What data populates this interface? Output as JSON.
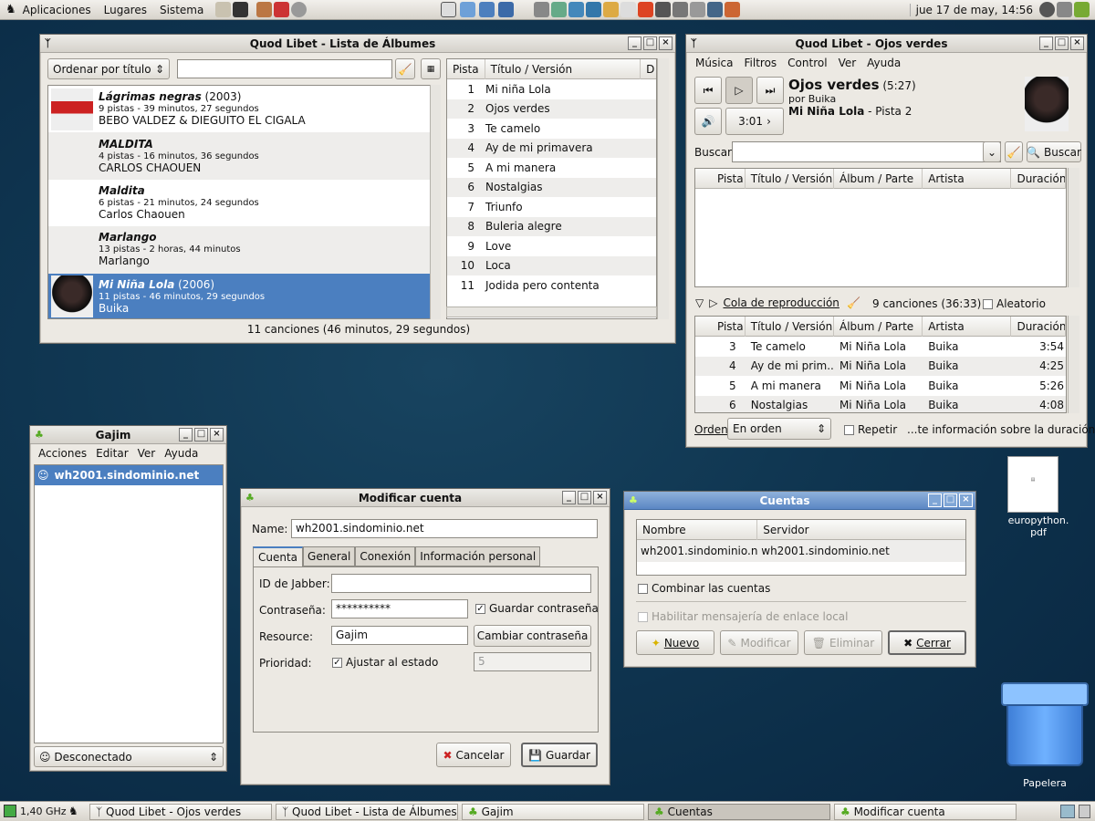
{
  "top_panel": {
    "menus": [
      "Aplicaciones",
      "Lugares",
      "Sistema"
    ],
    "clock": "jue 17 de may, 14:56"
  },
  "albums_window": {
    "title": "Quod Libet - Lista de Álbumes",
    "sort": "Ordenar por título",
    "albums": [
      {
        "title": "Lágrimas negras",
        "year": " (2003)",
        "info": "9 pistas - 39 minutos, 27 segundos",
        "artist": "BEBO VALDEZ & DIEGUITO EL CIGALA"
      },
      {
        "title": "MALDITA",
        "year": "",
        "info": "4 pistas - 16 minutos, 36 segundos",
        "artist": "CARLOS CHAOUEN"
      },
      {
        "title": "Maldita",
        "year": "",
        "info": "6 pistas - 21 minutos, 24 segundos",
        "artist": "Carlos Chaouen"
      },
      {
        "title": "Marlango",
        "year": "",
        "info": "13 pistas - 2 horas, 44 minutos",
        "artist": "Marlango"
      },
      {
        "title": "Mi Niña Lola",
        "year": " (2006)",
        "info": "11 pistas - 46 minutos, 29 segundos",
        "artist": "Buika"
      }
    ],
    "track_headers": [
      "Pista",
      "Título / Versión",
      "D"
    ],
    "tracks": [
      [
        "1",
        "Mi niña Lola"
      ],
      [
        "2",
        "Ojos verdes"
      ],
      [
        "3",
        "Te camelo"
      ],
      [
        "4",
        "Ay de mi primavera"
      ],
      [
        "5",
        "A mi manera"
      ],
      [
        "6",
        "Nostalgias"
      ],
      [
        "7",
        "Triunfo"
      ],
      [
        "8",
        "Buleria alegre"
      ],
      [
        "9",
        "Love"
      ],
      [
        "10",
        "Loca"
      ],
      [
        "11",
        "Jodida pero contenta"
      ]
    ],
    "status": "11 canciones (46 minutos, 29 segundos)"
  },
  "player_window": {
    "title": "Quod Libet - Ojos verdes",
    "menus": [
      "Música",
      "Filtros",
      "Control",
      "Ver",
      "Ayuda"
    ],
    "song": "Ojos verdes",
    "length": " (5:27)",
    "by": "por Buika",
    "album": "Mi Niña Lola",
    "track": " - Pista 2",
    "time": "3:01",
    "search_label": "Buscar",
    "search_button": "Buscar",
    "headers": [
      "Pista",
      "Título / Versión",
      "Álbum / Parte",
      "Artista",
      "Duración"
    ],
    "queue_label": "Cola de reproducción",
    "queue_count": "9 canciones (36:33)",
    "shuffle": "Aleatorio",
    "queue": [
      [
        "3",
        "Te camelo",
        "Mi Niña Lola",
        "Buika",
        "3:54"
      ],
      [
        "4",
        "Ay de mi prim...",
        "Mi Niña Lola",
        "Buika",
        "4:25"
      ],
      [
        "5",
        "A mi manera",
        "Mi Niña Lola",
        "Buika",
        "5:26"
      ],
      [
        "6",
        "Nostalgias",
        "Mi Niña Lola",
        "Buika",
        "4:08"
      ]
    ],
    "order_label": "Orden",
    "order_value": "En orden",
    "repeat": "Repetir",
    "info_text": "...te información sobre la duración)"
  },
  "gajim": {
    "title": "Gajim",
    "menus": [
      "Acciones",
      "Editar",
      "Ver",
      "Ayuda"
    ],
    "account": "wh2001.sindominio.net",
    "status": "Desconectado"
  },
  "modify": {
    "title": "Modificar cuenta",
    "name_label": "Name:",
    "name_value": "wh2001.sindominio.net",
    "tabs": [
      "Cuenta",
      "General",
      "Conexión",
      "Información personal"
    ],
    "jid_label": "ID de Jabber:",
    "pass_label": "Contraseña:",
    "pass_value": "**********",
    "save_pass": "Guardar contraseña",
    "resource_label": "Resource:",
    "resource_value": "Gajim",
    "change_pass": "Cambiar contraseña",
    "priority_label": "Prioridad:",
    "adjust": "Ajustar al estado",
    "priority_value": "5",
    "cancel": "Cancelar",
    "save": "Guardar"
  },
  "accounts": {
    "title": "Cuentas",
    "headers": [
      "Nombre",
      "Servidor"
    ],
    "row": [
      "wh2001.sindominio.net",
      "wh2001.sindominio.net"
    ],
    "merge": "Combinar las cuentas",
    "local": "Habilitar mensajería de enlace local",
    "new": "Nuevo",
    "modify": "Modificar",
    "delete": "Eliminar",
    "close": "Cerrar"
  },
  "desktop": {
    "pdf_label": "europython.\npdf",
    "trash_label": "Papelera"
  },
  "bottom_panel": {
    "cpu": "1,40 GHz",
    "tasks": [
      "Quod Libet - Ojos verdes",
      "Quod Libet - Lista de Álbumes",
      "Gajim",
      "Cuentas",
      "Modificar cuenta"
    ]
  },
  "colors": {
    "selection": "#4b7fc0",
    "desktop": "#0f3550"
  }
}
